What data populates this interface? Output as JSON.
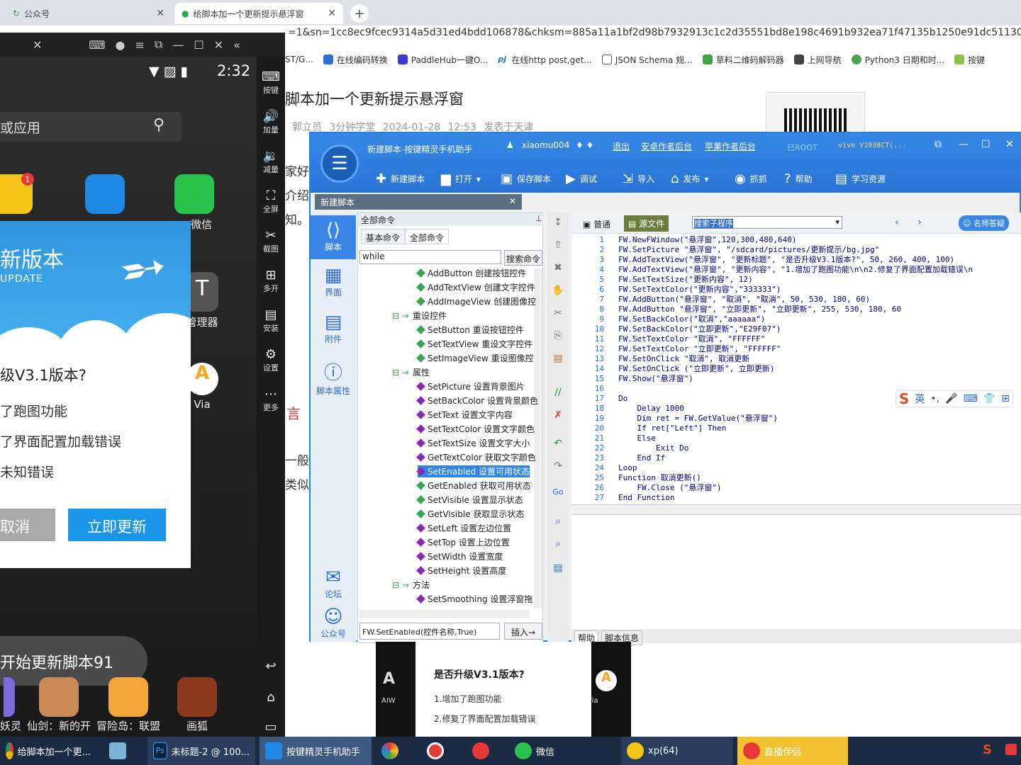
{
  "browser": {
    "tabs": [
      {
        "label": "公众号"
      },
      {
        "label": "给脚本加一个更新提示悬浮窗"
      }
    ],
    "url": "=1&sn=1cc8ec9fcec9314a5d31ed4bdd106878&chksm=885a11a1bf2d98b7932913c1c2d35551bd8e198c4691b932ea71f47135b1250e91dc511304e9&token",
    "bookmarks": [
      "ST/G...",
      "在线编码转换",
      "PaddleHub一键O...",
      "在线http post,get...",
      "JSON Schema 规...",
      "草料二维码解码器",
      "上网导航",
      "Python3 日期和时...",
      "按键"
    ]
  },
  "article": {
    "title": "脚本加一个更新提示悬浮窗",
    "meta": "郭立员   3分钟学堂   2024-01-28 12:53   发表于天津",
    "fragments": [
      "家好",
      "介绍",
      "知。",
      "言",
      "一般软",
      "类似"
    ]
  },
  "emulator": {
    "time": "2:32",
    "search_placeholder": "或应用",
    "sidebar": [
      {
        "label": "按键"
      },
      {
        "label": "加量"
      },
      {
        "label": "减量"
      },
      {
        "label": "全屏"
      },
      {
        "label": "截图"
      },
      {
        "label": "多开"
      },
      {
        "label": "安装"
      },
      {
        "label": "设置"
      },
      {
        "label": "更多"
      }
    ],
    "apps_right": [
      "微信",
      "管理器",
      "Via"
    ],
    "badge": "1",
    "dialog": {
      "heading": "新版本",
      "sub": "UPDATE",
      "question": "级V3.1版本?",
      "lines": [
        "了跑图功能",
        "了界面配置加载错误",
        "未知错误"
      ],
      "cancel": "取消",
      "update": "立即更新"
    },
    "toast": "开始更新脚本91",
    "dock": [
      "妖灵",
      "仙剑：新的开",
      "冒险岛：联盟",
      "画狐"
    ]
  },
  "ide": {
    "title": "新建脚本-按键精灵手机助手",
    "user": "xiaomu004",
    "links": [
      "退出",
      "安卓作者后台",
      "苹果作者后台"
    ],
    "root": "已ROOT",
    "device": "vivo  V1938CT(...",
    "toolbar": [
      "新建脚本",
      "打开",
      "保存脚本",
      "调试",
      "导入",
      "发布",
      "抓抓",
      "帮助",
      "学习资源"
    ],
    "file_tab": "新建脚本",
    "left_nav": [
      "脚本",
      "界面",
      "附件",
      "脚本属性",
      "论坛",
      "公众号"
    ],
    "cmd": {
      "header": "全部命令",
      "tabs": [
        "基本命令",
        "全部命令"
      ],
      "search": "while",
      "search_btn": "搜索命令",
      "items": [
        {
          "t": "AddButton 创建按钮控件",
          "k": "i"
        },
        {
          "t": "AddTextView 创建文字控件",
          "k": "i"
        },
        {
          "t": "AddImageView 创建图像控",
          "k": "i"
        },
        {
          "t": "重设控件",
          "k": "g"
        },
        {
          "t": "SetButton 重设按钮控件",
          "k": "i"
        },
        {
          "t": "SetTextView 重设文字控件",
          "k": "i"
        },
        {
          "t": "SetImageView 重设图像控",
          "k": "i"
        },
        {
          "t": "属性",
          "k": "g"
        },
        {
          "t": "SetPicture 设置背景图片",
          "k": "p"
        },
        {
          "t": "SetBackColor 设置背景颜色",
          "k": "p"
        },
        {
          "t": "SetText 设置文字内容",
          "k": "p"
        },
        {
          "t": "SetTextColor 设置文字颜色",
          "k": "p"
        },
        {
          "t": "SetTextSize 设置文字大小",
          "k": "p"
        },
        {
          "t": "GetTextColor 获取文字颜色",
          "k": "p"
        },
        {
          "t": "SetEnabled 设置可用状态",
          "k": "s"
        },
        {
          "t": "GetEnabled 获取可用状态",
          "k": "i"
        },
        {
          "t": "SetVisible 设置显示状态",
          "k": "i"
        },
        {
          "t": "GetVisible 获取显示状态",
          "k": "i"
        },
        {
          "t": "SetLeft 设置左边位置",
          "k": "p"
        },
        {
          "t": "SetTop 设置上边位置",
          "k": "p"
        },
        {
          "t": "SetWidth 设置宽度",
          "k": "p"
        },
        {
          "t": "SetHeight 设置高度",
          "k": "p"
        },
        {
          "t": "方法",
          "k": "g"
        },
        {
          "t": "SetSmoothing 设置浮窗拖",
          "k": "p"
        }
      ],
      "status": "FW.SetEnabled(控件名称,True)",
      "insert": "插入→"
    },
    "code_tool": {
      "normal": "普通",
      "source": "源文件",
      "search": "搜索子程序",
      "help": "名师答疑"
    },
    "code": [
      "FW.NewFWindow(\"悬浮窗\",120,300,480,640)",
      "FW.SetPicture \"悬浮窗\", \"/sdcard/pictures/更新提示/bg.jpg\"",
      "FW.AddTextView(\"悬浮窗\", \"更新标题\", \"是否升级V3.1版本?\", 50, 260, 400, 100)",
      "FW.AddTextView(\"悬浮窗\", \"更新内容\", \"1.增加了跑图功能\\n\\n2.修复了界面配置加载错误\\n",
      "FW.SetTextSize(\"更新内容\", 12)",
      "FW.SetTextColor(\"更新内容\",\"333333\")",
      "FW.AddButton(\"悬浮窗\", \"取消\", \"取消\", 50, 530, 180, 60)",
      "FW.AddButton \"悬浮窗\", \"立即更新\", \"立即更新\", 255, 530, 180, 60",
      "FW.SetBackColor(\"取消\",\"aaaaaa\")",
      "FW.SetBackColor(\"立即更新\",\"E29F07\")",
      "FW.SetTextColor \"取消\", \"FFFFFF\"",
      "FW.SetTextColor \"立即更新\", \"FFFFFF\"",
      "FW.SetOnClick \"取消\", 取消更新",
      "FW.SetOnClick (\"立即更新\", 立即更新)",
      "FW.Show(\"悬浮窗\")",
      "",
      "Do",
      "    Delay 1000",
      "    Dim ret = FW.GetValue(\"悬浮窗\")",
      "    If ret[\"Left\"] Then",
      "    Else",
      "        Exit Do",
      "    End If",
      "Loop",
      "Function 取消更新()",
      "    FW.Close (\"悬浮窗\")",
      "End Function"
    ],
    "line_numbers": [
      "1",
      "2",
      "3",
      "4",
      "5",
      "6",
      "7",
      "8",
      "9",
      "10",
      "11",
      "12",
      "13",
      "14",
      "15",
      "16",
      "17",
      "18",
      "19",
      "20",
      "21",
      "22",
      "23",
      "24",
      "25",
      "26",
      "27"
    ],
    "bottom_tabs": [
      "帮助",
      "脚本信息"
    ],
    "ime": "英"
  },
  "popup": {
    "question": "是否升级V3.1版本?",
    "lines": [
      "1.增加了跑图功能",
      "2.修复了界面配置加载错误"
    ],
    "left": "AIW",
    "right": "Via"
  },
  "taskbar": [
    {
      "label": "给脚本加一个更..."
    },
    {
      "label": ""
    },
    {
      "label": "未标题-2 @ 100..."
    },
    {
      "label": "按键精灵手机助手"
    },
    {
      "label": ""
    },
    {
      "label": ""
    },
    {
      "label": ""
    },
    {
      "label": "微信"
    },
    {
      "label": "xp(64)"
    },
    {
      "label": "直播伴侣"
    }
  ]
}
